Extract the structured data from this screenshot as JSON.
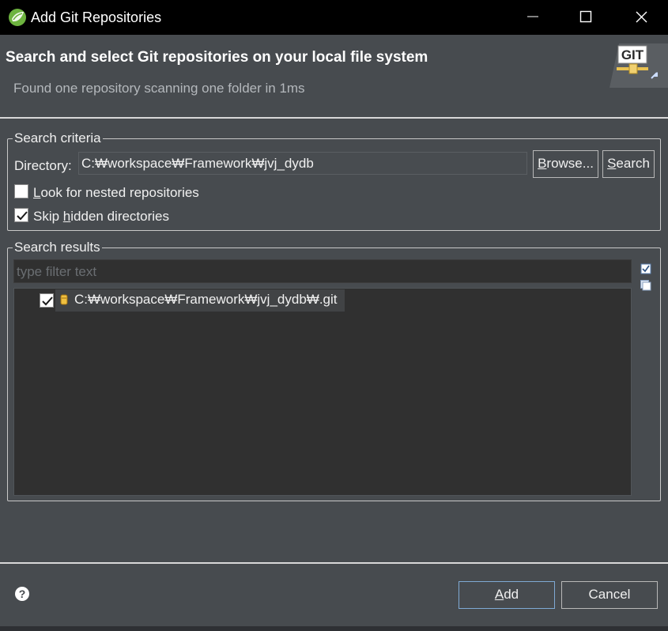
{
  "window": {
    "title": "Add Git Repositories"
  },
  "banner": {
    "title": "Search and select Git repositories on your local file system",
    "message": "Found one repository scanning one folder in 1ms",
    "logo_text": "GIT"
  },
  "criteria": {
    "legend": "Search criteria",
    "directory_label": "Directory:",
    "directory_value": "C:₩workspace₩Framework₩jvj_dydb",
    "browse_label": "Browse...",
    "search_label": "Search",
    "nested_label": "Look for nested repositories",
    "nested_checked": false,
    "hidden_label": "Skip hidden directories",
    "hidden_checked": true
  },
  "results": {
    "legend": "Search results",
    "filter_placeholder": "type filter text",
    "items": [
      {
        "path": "C:₩workspace₩Framework₩jvj_dydb₩.git",
        "checked": true
      }
    ]
  },
  "footer": {
    "add_label": "Add",
    "cancel_label": "Cancel"
  },
  "icons": [
    "eclipse-app-icon",
    "minimize-icon",
    "maximize-icon",
    "close-icon",
    "git-logo-icon",
    "check-icon",
    "repository-icon",
    "select-all-icon",
    "deselect-all-icon",
    "help-icon"
  ],
  "colors": {
    "background": "#474b4f",
    "titlebar": "#000000",
    "list_bg": "#303030",
    "accent_border": "#7fa9d4"
  }
}
